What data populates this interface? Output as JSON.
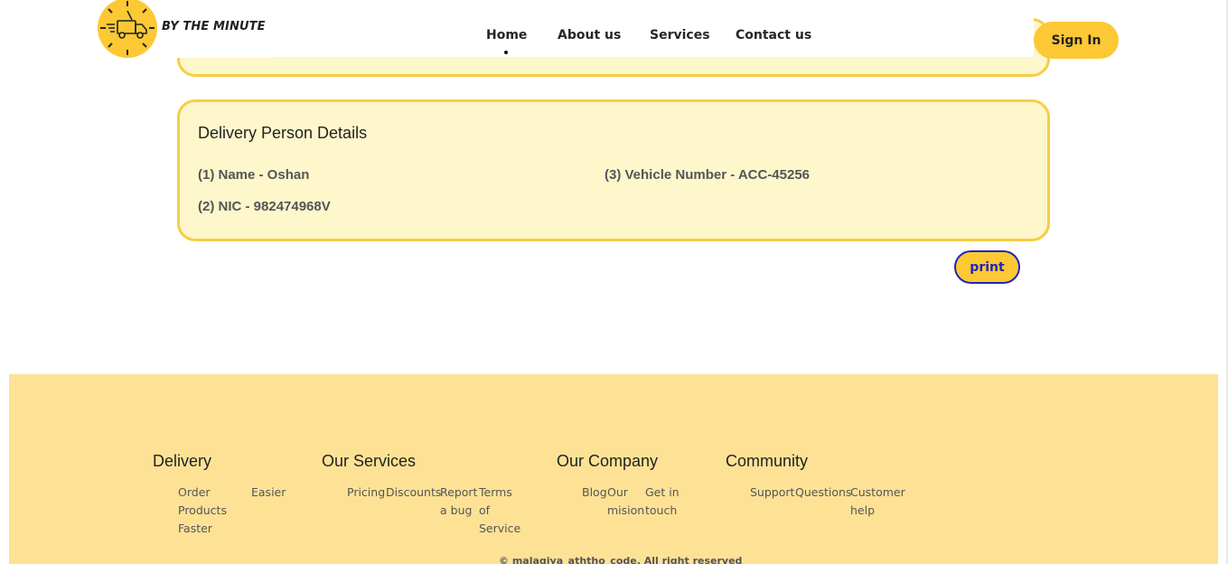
{
  "brand": {
    "name": "BY THE MINUTE",
    "accent": "#fcc934"
  },
  "nav": {
    "items": [
      {
        "label": "Home",
        "active": true
      },
      {
        "label": "About us"
      },
      {
        "label": "Services"
      },
      {
        "label": "Contact us"
      }
    ],
    "sign_in": "Sign In"
  },
  "delivery_person": {
    "title": "Delivery Person Details",
    "name": "(1) Name - Oshan",
    "nic": "(2) NIC - 982474968V",
    "vehicle": "(3) Vehicle Number - ACC-45256"
  },
  "actions": {
    "print": "print"
  },
  "footer": {
    "columns": [
      {
        "heading": "Delivery",
        "links": [
          "Order Products Faster",
          "Easier"
        ]
      },
      {
        "heading": "Our Services",
        "links": [
          "Pricing",
          "Discounts",
          "Report a bug",
          "Terms of Service"
        ]
      },
      {
        "heading": "Our Company",
        "links": [
          "Blog",
          "Our mision",
          "Get in touch"
        ]
      },
      {
        "heading": "Community",
        "links": [
          "Support",
          "Questions",
          "Customer help"
        ]
      }
    ],
    "copyright": "© malagiya_aththo_code. All right reserved"
  }
}
